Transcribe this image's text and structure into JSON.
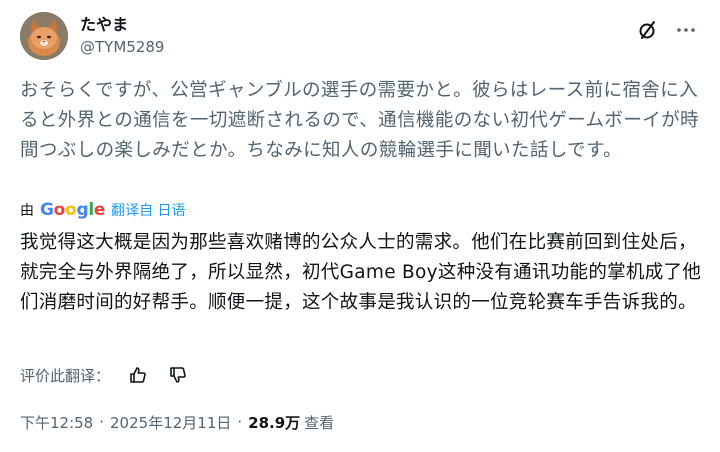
{
  "author": {
    "display_name": "たやま",
    "handle": "@TYM5289"
  },
  "post": {
    "original_text": "おそらくですが、公営ギャンブルの選手の需要かと。彼らはレース前に宿舎に入ると外界との通信を一切遮断されるので、通信機能のない初代ゲームボーイが時間つぶしの楽しみだとか。ちなみに知人の競輪選手に聞いた話しです。",
    "translated_text": "我觉得这大概是因为那些喜欢赌博的公众人士的需求。他们在比赛前回到住处后，就完全与外界隔绝了，所以显然，初代Game Boy这种没有通讯功能的掌机成了他们消磨时间的好帮手。顺便一提，这个故事是我认识的一位竞轮赛车手告诉我的。"
  },
  "translation": {
    "by_label": "由",
    "provider": "Google",
    "link_label": "翻译自 日语"
  },
  "rating": {
    "label": "评价此翻译："
  },
  "meta": {
    "time": "下午12:58",
    "date": "2025年12月11日",
    "views_count": "28.9万",
    "views_label": "查看"
  },
  "icons": {
    "grok": "slashed-circle-icon",
    "more": "more-icon",
    "thumbs_up": "thumbs-up-icon",
    "thumbs_down": "thumbs-down-icon"
  },
  "colors": {
    "secondary_text": "#536471",
    "link": "#1d9bf0",
    "primary_text": "#0f1419"
  }
}
